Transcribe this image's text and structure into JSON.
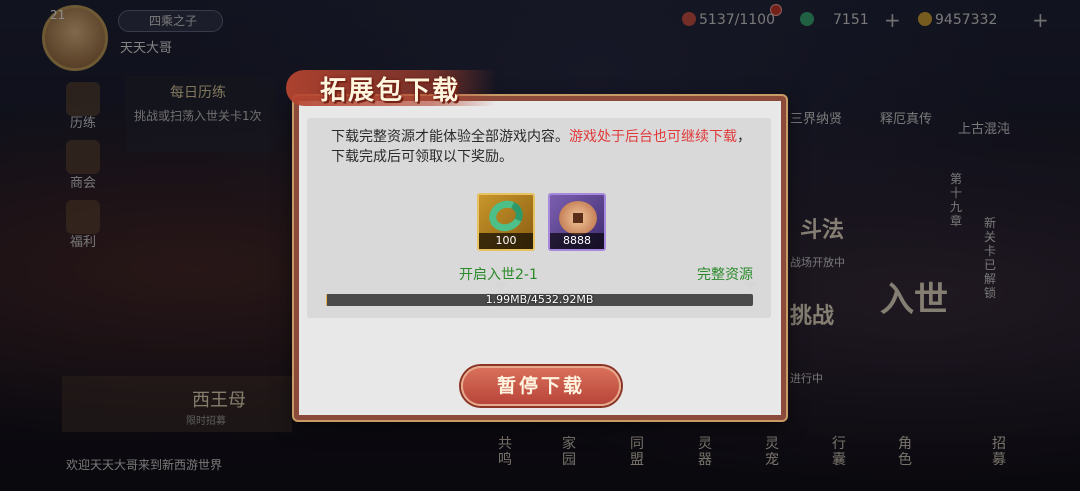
{
  "hud": {
    "level": "21",
    "title_badge": "四乘之子",
    "player_name": "天天大哥",
    "stamina": "5137/1100",
    "jade": "7151",
    "gold": "9457332"
  },
  "left_menu": [
    {
      "label": "历练"
    },
    {
      "label": "商会"
    },
    {
      "label": "福利"
    }
  ],
  "daily": {
    "heading": "每日历练",
    "text": "挑战或扫荡入世关卡1次"
  },
  "right_menu": {
    "sanjie": "三界纳贤",
    "shiyuan": "释厄真传",
    "shanggu": "上古混沌",
    "doufa": "斗法",
    "zhandou": "战场开放中",
    "tiaozhan": "挑战",
    "jinxing": "进行中",
    "ruishi": "入世",
    "chapter": "第十九章",
    "newlevel": "新关卡已解锁"
  },
  "event": {
    "name": "西王母",
    "sub": "限时招募"
  },
  "bottom_msg": "欢迎天天大哥来到新西游世界",
  "bottom_bar": [
    "共鸣",
    "家园",
    "同盟",
    "灵器",
    "灵宠",
    "行囊",
    "角色",
    "招募"
  ],
  "dialog": {
    "title": "拓展包下载",
    "desc_normal": "下载完整资源才能体验全部游戏内容。",
    "desc_red": "游戏处于后台也可继续下载",
    "desc_tail": "，下载完成后可领取以下奖励。",
    "rewards": [
      {
        "icon": "jade-ring-icon",
        "qty": "100"
      },
      {
        "icon": "copper-coin-icon",
        "qty": "8888"
      }
    ],
    "milestone_left": "开启入世2-1",
    "milestone_right": "完整资源",
    "progress_text": "1.99MB/4532.92MB",
    "progress_fraction": 0.00044,
    "button": "暂停下载"
  },
  "colors": {
    "accent_red": "#e03a3a",
    "milestone_green": "#2a8a2a",
    "button_red": "#c35a46",
    "frame_brown": "#8b4a3a"
  }
}
